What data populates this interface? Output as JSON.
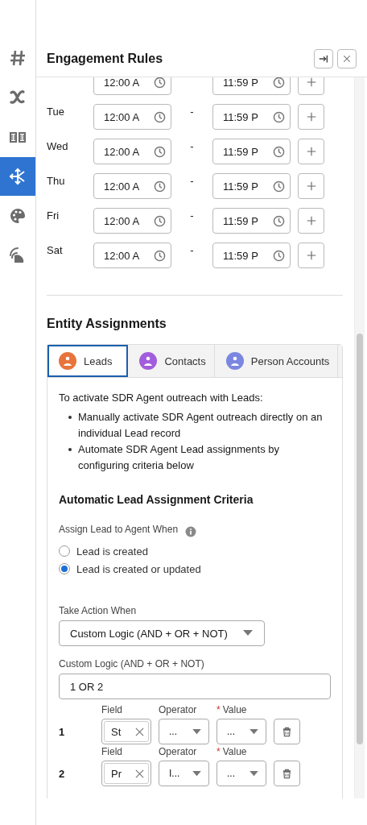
{
  "sidebar": {
    "items": [
      {
        "kind": "hash",
        "selected": false
      },
      {
        "kind": "variable",
        "selected": false
      },
      {
        "kind": "book",
        "selected": false
      },
      {
        "kind": "routing",
        "selected": true
      },
      {
        "kind": "palette",
        "selected": false
      },
      {
        "kind": "signal",
        "selected": false
      }
    ]
  },
  "panel": {
    "title": "Engagement Rules"
  },
  "schedule": [
    {
      "start": "12:00 A",
      "end": "11:59 P"
    },
    {
      "day": "Tue",
      "start": "12:00 A",
      "separator": "-",
      "end": "11:59 P"
    },
    {
      "day": "Wed",
      "start": "12:00 A",
      "separator": "-",
      "end": "11:59 P"
    },
    {
      "day": "Thu",
      "start": "12:00 A",
      "separator": "-",
      "end": "11:59 P"
    },
    {
      "day": "Fri",
      "start": "12:00 A",
      "separator": "-",
      "end": "11:59 P"
    },
    {
      "day": "Sat",
      "start": "12:00 A",
      "separator": "-",
      "end": "11:59 P"
    }
  ],
  "entity_assignments": {
    "title": "Entity Assignments",
    "tabs": [
      {
        "label": "Leads",
        "selected": true,
        "color": "#e8743b"
      },
      {
        "label": "Contacts",
        "selected": false,
        "color": "#a25ddc"
      },
      {
        "label": "Person Accounts",
        "selected": false,
        "color": "#7b86e0"
      }
    ],
    "intro": "To activate SDR Agent outreach with Leads:",
    "bullets": [
      "Manually activate SDR Agent outreach directly on an individual Lead record",
      "Automate SDR Agent Lead assignments by configuring criteria below"
    ],
    "criteria_title": "Automatic Lead Assignment Criteria",
    "assign_label": "Assign Lead to Agent When",
    "radios": [
      {
        "label": "Lead is created",
        "selected": false
      },
      {
        "label": "Lead is created or updated",
        "selected": true
      }
    ],
    "take_action_label": "Take Action When",
    "take_action_value": "Custom Logic (AND + OR + NOT)",
    "custom_logic_label": "Custom Logic (AND + OR + NOT)",
    "custom_logic_value": "1 OR 2",
    "conditions": [
      {
        "number": "1",
        "field_label": "Field",
        "field_value": "St",
        "operator_label": "Operator",
        "operator_value": "...",
        "required_mark": "*",
        "value_label": "Value",
        "value": "..."
      },
      {
        "number": "2",
        "field_label": "Field",
        "field_value": "Pr",
        "operator_label": "Operator",
        "operator_value": "I...",
        "required_mark": "*",
        "value_label": "Value",
        "value": "..."
      }
    ]
  }
}
